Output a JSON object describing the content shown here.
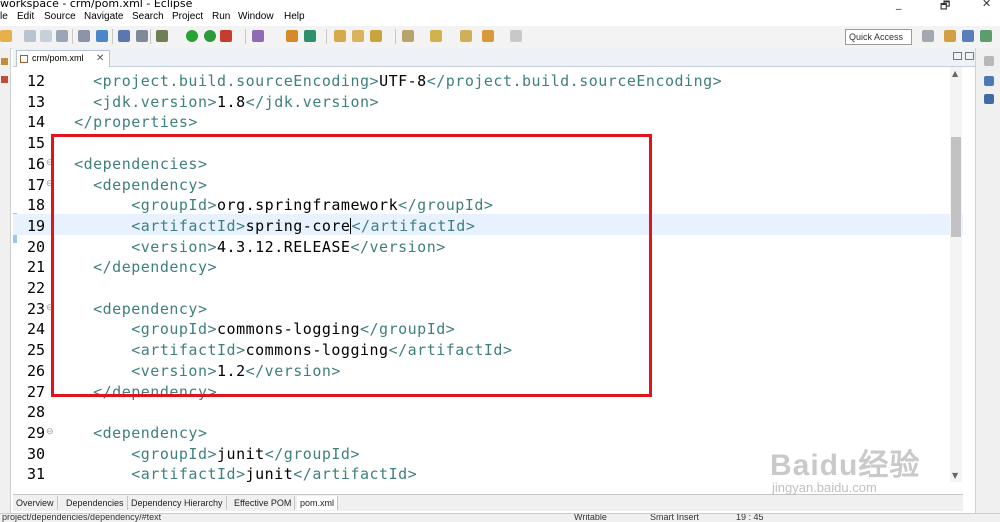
{
  "window": {
    "title": "workspace - crm/pom.xml - Eclipse",
    "minimize": "_",
    "restore": "🗗",
    "close": "✕"
  },
  "menu": [
    "le",
    "Edit",
    "Source",
    "Navigate",
    "Search",
    "Project",
    "Run",
    "Window",
    "Help"
  ],
  "toolbar": {
    "quick_access": "Quick Access"
  },
  "editor_tab": {
    "label": "crm/pom.xml",
    "close": "✕"
  },
  "code_lines": [
    {
      "num": "12",
      "fold": "",
      "indent": "    ",
      "parts": [
        {
          "t": "tag",
          "v": "<project.build.sourceEncoding>"
        },
        {
          "t": "txt",
          "v": "UTF-8"
        },
        {
          "t": "tag",
          "v": "</project.build.sourceEncoding>"
        }
      ]
    },
    {
      "num": "13",
      "fold": "",
      "indent": "    ",
      "parts": [
        {
          "t": "tag",
          "v": "<jdk.version>"
        },
        {
          "t": "txt",
          "v": "1.8"
        },
        {
          "t": "tag",
          "v": "</jdk.version>"
        }
      ]
    },
    {
      "num": "14",
      "fold": "",
      "indent": "  ",
      "parts": [
        {
          "t": "tag",
          "v": "</properties>"
        }
      ]
    },
    {
      "num": "15",
      "fold": "",
      "indent": "",
      "parts": []
    },
    {
      "num": "16",
      "fold": "⊖",
      "indent": "  ",
      "parts": [
        {
          "t": "tag",
          "v": "<dependencies>"
        }
      ]
    },
    {
      "num": "17",
      "fold": "⊖",
      "indent": "    ",
      "parts": [
        {
          "t": "tag",
          "v": "<dependency>"
        }
      ]
    },
    {
      "num": "18",
      "fold": "",
      "indent": "        ",
      "parts": [
        {
          "t": "tag",
          "v": "<groupId>"
        },
        {
          "t": "txt",
          "v": "org.springframework"
        },
        {
          "t": "tag",
          "v": "</groupId>"
        }
      ]
    },
    {
      "num": "19",
      "fold": "",
      "indent": "        ",
      "highlight": true,
      "parts": [
        {
          "t": "tag",
          "v": "<artifactId>"
        },
        {
          "t": "txt",
          "v": "spring-core"
        },
        {
          "t": "caret",
          "v": ""
        },
        {
          "t": "tag",
          "v": "</artifactId>"
        }
      ]
    },
    {
      "num": "20",
      "fold": "",
      "indent": "        ",
      "parts": [
        {
          "t": "tag",
          "v": "<version>"
        },
        {
          "t": "txt",
          "v": "4.3.12.RELEASE"
        },
        {
          "t": "tag",
          "v": "</version>"
        }
      ]
    },
    {
      "num": "21",
      "fold": "",
      "indent": "    ",
      "parts": [
        {
          "t": "tag",
          "v": "</dependency>"
        }
      ]
    },
    {
      "num": "22",
      "fold": "",
      "indent": "",
      "parts": []
    },
    {
      "num": "23",
      "fold": "⊖",
      "indent": "    ",
      "parts": [
        {
          "t": "tag",
          "v": "<dependency>"
        }
      ]
    },
    {
      "num": "24",
      "fold": "",
      "indent": "        ",
      "parts": [
        {
          "t": "tag",
          "v": "<groupId>"
        },
        {
          "t": "txt",
          "v": "commons-logging"
        },
        {
          "t": "tag",
          "v": "</groupId>"
        }
      ]
    },
    {
      "num": "25",
      "fold": "",
      "indent": "        ",
      "parts": [
        {
          "t": "tag",
          "v": "<artifactId>"
        },
        {
          "t": "txt",
          "v": "commons-logging"
        },
        {
          "t": "tag",
          "v": "</artifactId>"
        }
      ]
    },
    {
      "num": "26",
      "fold": "",
      "indent": "        ",
      "parts": [
        {
          "t": "tag",
          "v": "<version>"
        },
        {
          "t": "txt",
          "v": "1.2"
        },
        {
          "t": "tag",
          "v": "</version>"
        }
      ]
    },
    {
      "num": "27",
      "fold": "",
      "indent": "    ",
      "parts": [
        {
          "t": "tag",
          "v": "</dependency>"
        }
      ]
    },
    {
      "num": "28",
      "fold": "",
      "indent": "",
      "parts": []
    },
    {
      "num": "29",
      "fold": "⊖",
      "indent": "    ",
      "parts": [
        {
          "t": "tag",
          "v": "<dependency>"
        }
      ]
    },
    {
      "num": "30",
      "fold": "",
      "indent": "        ",
      "parts": [
        {
          "t": "tag",
          "v": "<groupId>"
        },
        {
          "t": "txt",
          "v": "junit"
        },
        {
          "t": "tag",
          "v": "</groupId>"
        }
      ]
    },
    {
      "num": "31",
      "fold": "",
      "indent": "        ",
      "parts": [
        {
          "t": "tag",
          "v": "<artifactId>"
        },
        {
          "t": "txt",
          "v": "junit"
        },
        {
          "t": "tag",
          "v": "</artifactId>"
        }
      ]
    }
  ],
  "pom_tabs": [
    "Overview",
    "Dependencies",
    "Dependency Hierarchy",
    "Effective POM",
    "pom.xml"
  ],
  "pom_tabs_active": "pom.xml",
  "status": {
    "path": "project/dependencies/dependency/#text",
    "writable": "Writable",
    "insert": "Smart Insert",
    "position": "19 : 45"
  },
  "watermark": {
    "brand": "Baidu经验",
    "url": "jingyan.baidu.com"
  },
  "colors": {
    "xml_tag": "#3f7f7f",
    "current_line": "#e8f2fe",
    "annotation_box": "#e0141c"
  }
}
